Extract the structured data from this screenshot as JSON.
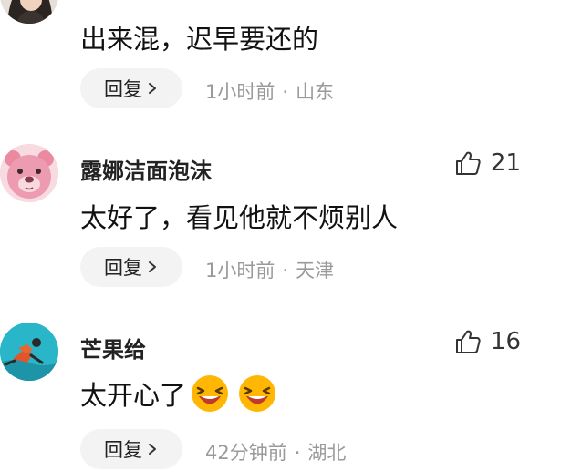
{
  "comments": [
    {
      "avatar": "woman-photo-avatar",
      "text": "出来混，迟早要还的",
      "reply_label": "回复",
      "time": "1小时前",
      "location": "山东"
    },
    {
      "username": "露娜洁面泡沫",
      "avatar": "pink-bear-avatar",
      "likes": "21",
      "text": "太好了，看见他就不烦别人",
      "reply_label": "回复",
      "time": "1小时前",
      "location": "天津"
    },
    {
      "username": "芒果给",
      "avatar": "snorkel-swimmer-avatar",
      "likes": "16",
      "text": "太开心了",
      "emojis": [
        "laughing-face-emoji",
        "laughing-face-emoji"
      ],
      "reply_label": "回复",
      "time": "42分钟前",
      "location": "湖北"
    }
  ],
  "icons": {
    "like": "thumbs-up-icon",
    "reply_arrow": "chevron-right-icon"
  },
  "colors": {
    "meta_text": "#9a9a9a",
    "reply_bg": "#f3f3f3",
    "emoji_yellow": "#ffb703"
  }
}
